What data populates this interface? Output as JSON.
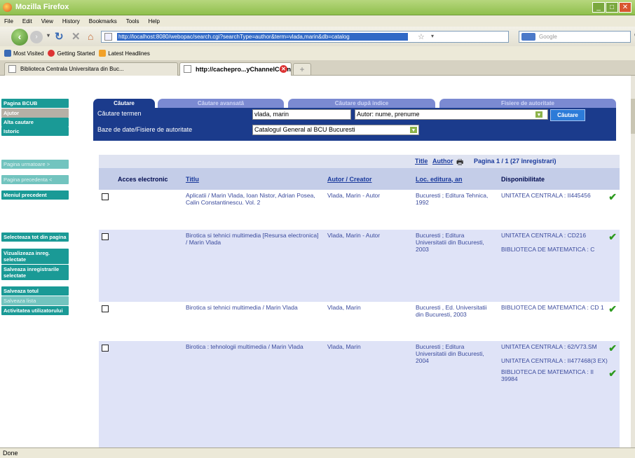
{
  "window": {
    "title": "Mozilla Firefox",
    "min_icon": "minimize-icon",
    "max_icon": "maximize-icon",
    "close_icon": "close-icon"
  },
  "menu": [
    "File",
    "Edit",
    "View",
    "History",
    "Bookmarks",
    "Tools",
    "Help"
  ],
  "nav": {
    "url": "http://localhost:8080/webopac/search.cgi?searchType=author&term=vlada,marin&db=catalog",
    "search_placeholder": "Google"
  },
  "bookmarks": [
    "Most Visited",
    "Getting Started",
    "Latest Headlines"
  ],
  "tabs": [
    {
      "label": "Biblioteca Centrala Universitara din Buc..."
    },
    {
      "label": "http://cachepro...yChannelCount="
    }
  ],
  "sidebar": [
    {
      "label": "Pagina BCUB",
      "state": "active"
    },
    {
      "label": "Ajutor",
      "state": "selected"
    },
    {
      "label": "Alta cautare",
      "state": "active"
    },
    {
      "label": "Istoric",
      "state": "active"
    },
    {
      "label": "Pagina urmatoare >",
      "state": "disabled"
    },
    {
      "label": "Pagina precedenta <",
      "state": "disabled"
    },
    {
      "label": "Meniul precedent",
      "state": "active"
    },
    {
      "label": "Selecteaza tot din pagina",
      "state": "active"
    },
    {
      "label": "Vizualizeaza inreg. selectate",
      "state": "active"
    },
    {
      "label": "Salveaza inregistrarile selectate",
      "state": "active"
    },
    {
      "label": "Salveaza totul",
      "state": "active"
    },
    {
      "label": "Salveaza lista",
      "state": "disabled"
    },
    {
      "label": "Activitatea utilizatorului",
      "state": "active"
    }
  ],
  "search": {
    "tabs": [
      "Căutare",
      "Căutare avansată",
      "Căutare după indice",
      "Fisiere de autoritate"
    ],
    "term_label": "Căutare termen",
    "term_value": "vlada, marin",
    "field_value": "Autor: nume, prenume",
    "db_label": "Baze de date/Fisiere de autoritate",
    "db_value": "Catalogul General al BCU Bucuresti",
    "button": "Căutare"
  },
  "results": {
    "sort_title": "Title",
    "sort_author": "Author",
    "print_icon": "print-icon",
    "pagination": "Pagina 1 / 1 (27 înregistrari)",
    "columns": [
      "Acces electronic",
      "Titlu",
      "Autor / Creator",
      "Loc. editura, an",
      "Disponibilitate"
    ],
    "rows": [
      {
        "title": "Aplicatii / Marin Vlada, Ioan Nistor, Adrian Posea, Calin Constantinescu. Vol. 2",
        "author": "Vlada, Marin - Autor",
        "publisher": "Bucuresti ; Editura Tehnica, 1992",
        "availability": [
          {
            "text": "UNITATEA CENTRALA : II445456",
            "check": true
          }
        ]
      },
      {
        "title": "Birotica si tehnici multimedia [Resursa electronica] / Marin Vlada",
        "author": "Vlada, Marin - Autor",
        "publisher": "Bucuresti ; Editura Universitatii din Bucuresti, 2003",
        "availability": [
          {
            "text": "UNITATEA CENTRALA : CD216",
            "check": true
          },
          {
            "text": "BIBLIOTECA DE MATEMATICA : C",
            "check": false
          }
        ]
      },
      {
        "title": "Birotica si tehnici multimedia / Marin Vlada",
        "author": "Vlada, Marin",
        "publisher": "Bucuresti , Ed. Universitatii din Bucuresti, 2003",
        "availability": [
          {
            "text": "BIBLIOTECA DE MATEMATICA : CD 1",
            "check": true
          }
        ]
      },
      {
        "title": "Birotica : tehnologii multimedia / Marin Vlada",
        "author": "Vlada, Marin",
        "publisher": "Bucuresti ; Editura Universitatii din Bucuresti, 2004",
        "availability": [
          {
            "text": "UNITATEA CENTRALA : 62/V73.SM",
            "check": true
          },
          {
            "text": "UNITATEA CENTRALA : II477468(3 EX)",
            "check": false
          },
          {
            "text": "BIBLIOTECA DE MATEMATICA : II 39984",
            "check": true
          }
        ]
      }
    ]
  },
  "status": "Done",
  "colors": {
    "nav_dark": "#1b3b8c",
    "sidebar_teal": "#1a9a96",
    "row_alt": "#dfe3f7",
    "check_green": "#2d9a1f"
  }
}
